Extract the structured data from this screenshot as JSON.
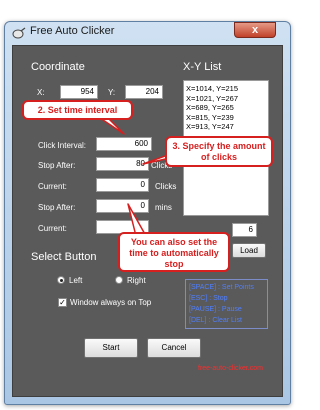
{
  "window": {
    "title": "Free Auto Clicker",
    "close_glyph": "x"
  },
  "coordinate": {
    "heading": "Coordinate",
    "x_label": "X:",
    "x_value": "954",
    "y_label": "Y:",
    "y_value": "204"
  },
  "xy_list": {
    "heading": "X-Y List",
    "items": [
      "X=1014, Y=215",
      "X=1021, Y=267",
      "X=689, Y=265",
      "X=815, Y=239",
      "X=913, Y=247"
    ],
    "count_value": "6",
    "load_label": "Load"
  },
  "form": {
    "click_interval_label": "Click Interval:",
    "click_interval_value": "600",
    "stop_after_label": "Stop After:",
    "stop_after_value": "80",
    "stop_after_unit": "Clicks",
    "current_label": "Current:",
    "current_value": "0",
    "current_unit": "Clicks",
    "stop_after2_label": "Stop After:",
    "stop_after2_value": "0",
    "stop_after2_unit": "mins",
    "current2_label": "Current:"
  },
  "select_button": {
    "heading": "Select Button",
    "left_label": "Left",
    "right_label": "Right",
    "selected": "Left",
    "always_on_top_label": "Window always on Top",
    "always_on_top_checked": true
  },
  "hotkeys": [
    "[SPACE] : Set Points",
    "[ESC] : Stop",
    "[PAUSE] : Pause",
    "[DEL] : Clear List"
  ],
  "buttons": {
    "start": "Start",
    "cancel": "Cancel"
  },
  "footer_link": "free-auto-clicker.com",
  "callouts": {
    "interval": "2. Set time interval",
    "amount": "3. Specify the amount of clicks",
    "time": "You can also set the time to automatically stop"
  },
  "colors": {
    "callout_red": "#d61f1f",
    "panel": "#5a5a5a",
    "hotkey_blue": "#4f7fff"
  }
}
